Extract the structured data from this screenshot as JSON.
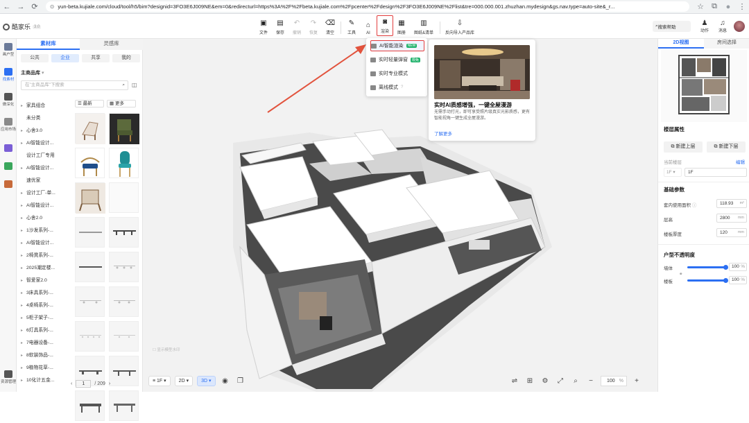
{
  "browser": {
    "url": "yun-beta.kujiale.com/cloud/tool/h5/bim?designid=3FO3E6J009NE&em=0&redirecturl=https%3A%2F%2Fbeta.kujiale.com%2Fpcenter%2Fdesign%2F3FO3E6J009NE%2Flist&tre=000.000.001.zhuzhan.mydesign&gs.nav.type=auto-site&_r..."
  },
  "app": {
    "logo": "酷家乐",
    "version": "3.0"
  },
  "toolbar": {
    "items": [
      "文件",
      "保存",
      "撤销",
      "恢复",
      "清空",
      "工具",
      "AI",
      "渲染",
      "图册",
      "图纸&清单",
      "反向导入产品库"
    ]
  },
  "header_right": {
    "search": "搜索帮助",
    "activity": "动作",
    "messages": "消息"
  },
  "rail": {
    "items": [
      "画户型",
      "找素材",
      "做深化",
      "应用市场",
      "资源管理"
    ]
  },
  "panel": {
    "tabs": [
      "素材库",
      "灵感库"
    ],
    "scopes": [
      "公共",
      "企业",
      "共享",
      "我的"
    ],
    "main_lib": "主商品库",
    "search_placeholder": "在\"主商品库\"下搜索",
    "sort_latest": "最新",
    "sort_more": "更多",
    "categories": [
      "家具组合",
      "未分类",
      "心舍3.0",
      "AI智能设计...",
      "设计工厂专用",
      "AI智能设计...",
      "速优家",
      "设计工厂-单...",
      "AI智能设计...",
      "心舍2.0",
      "1沙发系列-...",
      "AI智能设计...",
      "2椅凳系列-...",
      "2025潮定楼...",
      "智爱家2.0",
      "3床具系列-...",
      "4桌椅系列-...",
      "5柜子架子-...",
      "6灯具系列-...",
      "7电器设备-...",
      "8软装饰品-...",
      "9植物花草-...",
      "10化计五金..."
    ],
    "page": "1",
    "total_pages": "/ 209"
  },
  "render_menu": {
    "items": [
      "AI智能渲染",
      "实时轻量弹窗",
      "实时专业模式",
      "离线模式"
    ],
    "badge_new": "NEW",
    "badge_hot": "限免"
  },
  "preview": {
    "title": "实时AI质感增强，一键全屋漫游",
    "desc": "无需手动打光，即可享受照片级真实光影质感，更有智能视角一键生成全屋漫游。",
    "more": "了解更多"
  },
  "canvas": {
    "watermark": "显示模型水印",
    "floor": "1F",
    "view_2d": "2D",
    "view_3d": "3D",
    "zoom": "100",
    "zoom_unit": "%"
  },
  "right_panel": {
    "tabs": [
      "2D视图",
      "房间选择"
    ],
    "floor_props": "楼层属性",
    "add_up": "新建上层",
    "add_down": "新建下层",
    "current_floor_label": "当前楼层",
    "floor_icon_label": "1F",
    "current_floor": "1F",
    "edit": "编辑",
    "basic": "基础参数",
    "area_label": "套内使用面积",
    "area": "118.93",
    "area_unit": "m²",
    "height_label": "层高",
    "height": "2800",
    "thickness_label": "楼板厚度",
    "thickness": "120",
    "mm": "mm",
    "opacity": "户型不透明度",
    "wall_label": "墙体",
    "wall_val": "100",
    "slab_label": "楼板",
    "slab_val": "100",
    "pct": "%"
  },
  "colors": {
    "accent": "#2c6ff2",
    "highlight": "#e23d3d",
    "badge": "#20b26b"
  }
}
